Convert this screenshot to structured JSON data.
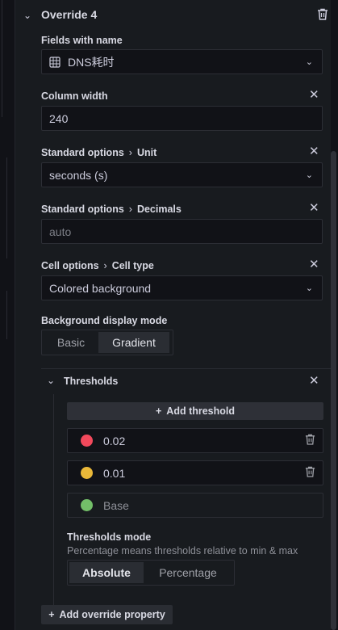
{
  "override": {
    "title": "Override 4"
  },
  "fields_with_name": {
    "label": "Fields with name",
    "value": "DNS耗时"
  },
  "column_width": {
    "label": "Column width",
    "value": "240"
  },
  "unit": {
    "label_a": "Standard options",
    "label_b": "Unit",
    "value": "seconds (s)"
  },
  "decimals": {
    "label_a": "Standard options",
    "label_b": "Decimals",
    "placeholder": "auto"
  },
  "cell_type": {
    "label_a": "Cell options",
    "label_b": "Cell type",
    "value": "Colored background"
  },
  "bg_mode": {
    "label": "Background display mode",
    "options": [
      "Basic",
      "Gradient"
    ],
    "selected": "Gradient"
  },
  "thresholds": {
    "label": "Thresholds",
    "add_label": "Add threshold",
    "items": [
      {
        "value": "0.02",
        "color": "#f2495c"
      },
      {
        "value": "0.01",
        "color": "#eab839"
      },
      {
        "value": "Base",
        "color": "#73bf69"
      }
    ],
    "mode_label": "Thresholds mode",
    "mode_hint": "Percentage means thresholds relative to min & max",
    "mode_options": [
      "Absolute",
      "Percentage"
    ],
    "mode_selected": "Absolute"
  },
  "add_override_property": "Add override property",
  "icons": [
    "chevron-down-icon",
    "trash-icon",
    "close-icon",
    "field-grid-icon",
    "plus-icon"
  ]
}
